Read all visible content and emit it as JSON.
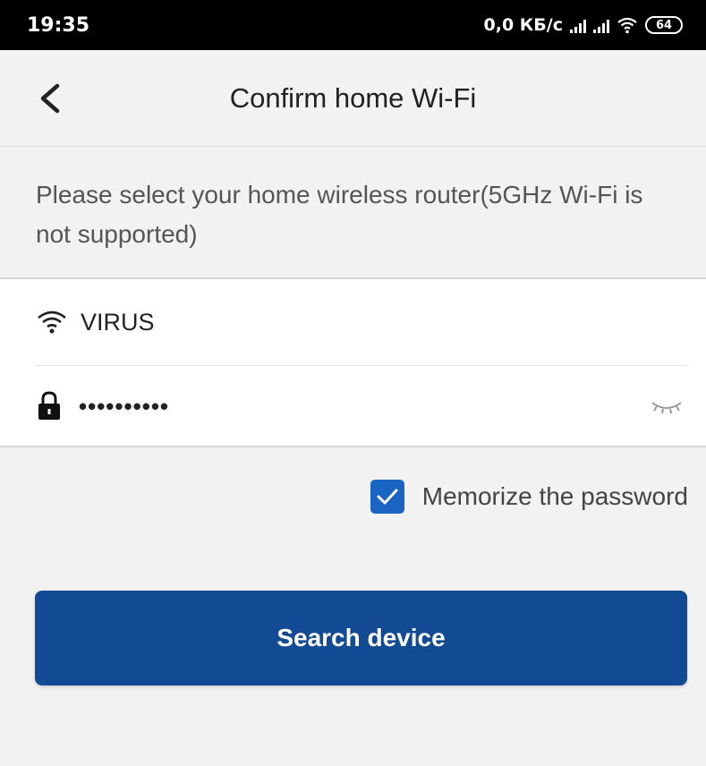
{
  "status_bar": {
    "time": "19:35",
    "network_speed": "0,0 КБ/с",
    "battery_level": "64",
    "icons": [
      "signal-icon",
      "signal-icon",
      "wifi-icon",
      "battery-icon"
    ]
  },
  "header": {
    "title": "Confirm home Wi-Fi",
    "back_icon": "chevron-left-icon"
  },
  "hint": "Please select your home wireless router(5GHz Wi-Fi is not supported)",
  "form": {
    "ssid": "VIRUS",
    "ssid_icon": "wifi-icon",
    "password_masked": "••••••••••",
    "password_icon": "lock-icon",
    "toggle_icon": "eye-closed-icon"
  },
  "memorize": {
    "checked": true,
    "label": "Memorize the password"
  },
  "search_button": {
    "label": "Search device"
  },
  "colors": {
    "accent": "#124b94",
    "checkbox": "#1a64c4",
    "background": "#f2f2f2"
  }
}
